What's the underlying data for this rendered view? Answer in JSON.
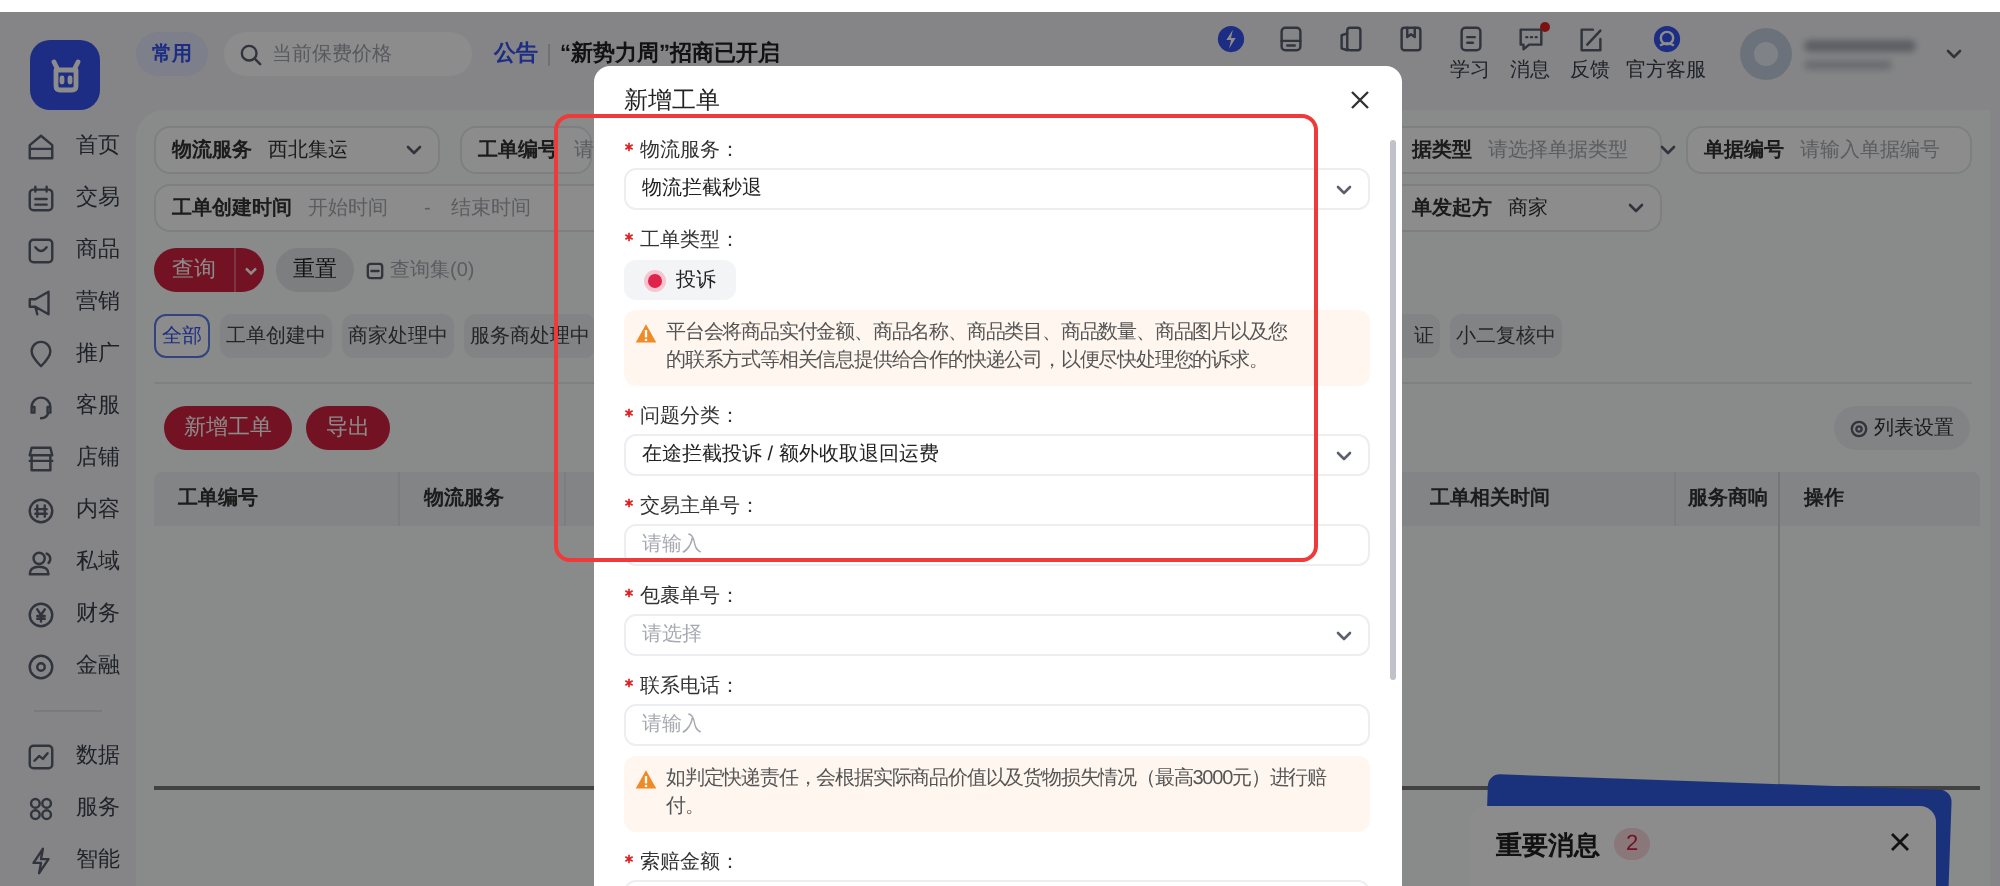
{
  "top_bar": {
    "quick_link": "常用",
    "search": {
      "placeholder": "当前保费价格"
    },
    "notice_label": "公告",
    "notice_text": "“新势力周”招商已开启",
    "tools": [
      {
        "unread": false
      },
      {
        "unread": false
      },
      {
        "unread": false
      },
      {
        "unread": false
      },
      {
        "label": "学习",
        "unread": false
      },
      {
        "label": "消息",
        "unread": true
      },
      {
        "label": "反馈",
        "unread": false
      },
      {
        "label": "官方客服",
        "unread": false
      }
    ]
  },
  "sidebar": {
    "main_items": [
      "首页",
      "交易",
      "商品",
      "营销",
      "推广",
      "客服",
      "店铺",
      "内容",
      "私域",
      "财务",
      "金融"
    ],
    "tool_items": [
      "数据",
      "服务",
      "智能"
    ]
  },
  "filter_rows": [
    {
      "left": [
        {
          "kind": "select",
          "label": "物流服务",
          "value": "西北集运"
        },
        {
          "kind": "input",
          "label": "工单编号",
          "placeholder": "请"
        }
      ],
      "right": [
        {
          "kind": "select",
          "label": "据类型",
          "placeholder": "请选择单据类型"
        },
        {
          "kind": "input",
          "label": "单据编号",
          "placeholder": "请输入单据编号"
        }
      ]
    },
    {
      "left": [
        {
          "kind": "range",
          "label": "工单创建时间",
          "start_placeholder": "开始时间",
          "separator": "-",
          "end_placeholder": "结束时间"
        }
      ],
      "right": [
        {
          "kind": "select",
          "label": "单发起方",
          "value": "商家"
        }
      ]
    }
  ],
  "query_button": "查询",
  "reset_button": "重置",
  "saved_queries": "查询集(0)",
  "status_tabs": [
    {
      "label": "全部",
      "selected": true
    },
    {
      "label": "工单创建中",
      "selected": false
    },
    {
      "label": "商家处理中",
      "selected": false
    },
    {
      "label": "服务商处理中",
      "selected": false
    },
    {
      "label": "证",
      "selected": false
    },
    {
      "label": "小二复核中",
      "selected": false
    }
  ],
  "actions": [
    "新增工单",
    "导出"
  ],
  "list_settings": "列表设置",
  "table": {
    "columns": [
      "工单编号",
      "物流服务",
      "工单相关时间",
      "服务商响",
      "操作"
    ]
  },
  "message_card": {
    "title": "重要消息",
    "count": "2"
  },
  "dialog": {
    "title": "新增工单",
    "fields": [
      {
        "kind": "select",
        "label": "物流服务：",
        "required": true,
        "value": "物流拦截秒退"
      },
      {
        "kind": "radio",
        "label": "工单类型：",
        "required": true,
        "options": [
          {
            "label": "投诉",
            "selected": true
          }
        ]
      },
      {
        "kind": "notice",
        "text": "平台会将商品实付金额、商品名称、商品类目、商品数量、商品图片以及您的联系方式等相关信息提供给合作的快递公司，以便尽快处理您的诉求。"
      },
      {
        "kind": "select",
        "label": "问题分类：",
        "required": true,
        "value": "在途拦截投诉 / 额外收取退回运费"
      },
      {
        "kind": "input",
        "label": "交易主单号：",
        "required": true,
        "placeholder": "请输入"
      },
      {
        "kind": "select",
        "label": "包裹单号：",
        "required": true,
        "placeholder": "请选择"
      },
      {
        "kind": "input",
        "label": "联系电话：",
        "required": true,
        "placeholder": "请输入"
      },
      {
        "kind": "notice",
        "text": "如判定快递责任，会根据实际商品价值以及货物损失情况（最高3000元）进行赔付。"
      },
      {
        "kind": "input",
        "label": "索赔金额：",
        "required": true
      }
    ]
  }
}
